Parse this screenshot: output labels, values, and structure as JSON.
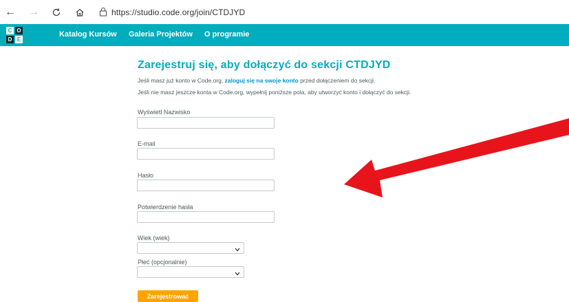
{
  "browser": {
    "url": "https://studio.code.org/join/CTDJYD",
    "icons": [
      "back-icon",
      "forward-icon",
      "refresh-icon",
      "home-icon",
      "lock-icon"
    ]
  },
  "header": {
    "logo_letters": [
      "C",
      "O",
      "D",
      "E"
    ],
    "nav": [
      {
        "label": "Katalog Kursów"
      },
      {
        "label": "Galeria Projektów"
      },
      {
        "label": "O programie"
      }
    ],
    "background_color": "#00adbc"
  },
  "form": {
    "title": "Zarejestruj się, aby dołączyć do sekcji CTDJYD",
    "info_line1_before": "Jeśli masz już konto w Code.org, ",
    "info_line1_link": "zaloguj się na swoje konto",
    "info_line1_after": " przed dołączeniem do sekcji.",
    "info_line2": "Jeśli nie masz jeszcze konta w Code.org, wypełnij poniższe pola, aby utworzyć konto i dołączyć do sekcji.",
    "fields": {
      "display_name": {
        "label": "Wyświetl Nazwisko",
        "value": ""
      },
      "email": {
        "label": "E-mail",
        "value": ""
      },
      "password": {
        "label": "Hasło",
        "value": ""
      },
      "password_confirm": {
        "label": "Potwierdzenie hasła",
        "value": ""
      },
      "age": {
        "label": "Wiek (wiek)",
        "value": ""
      },
      "gender": {
        "label": "Płeć (opcjonalnie)",
        "value": ""
      }
    },
    "submit_label": "Zarejestrować",
    "accent_color": "#ffa400"
  },
  "annotation": {
    "arrow_color": "#e8141c",
    "arrow_direction": "pointing left toward form"
  }
}
